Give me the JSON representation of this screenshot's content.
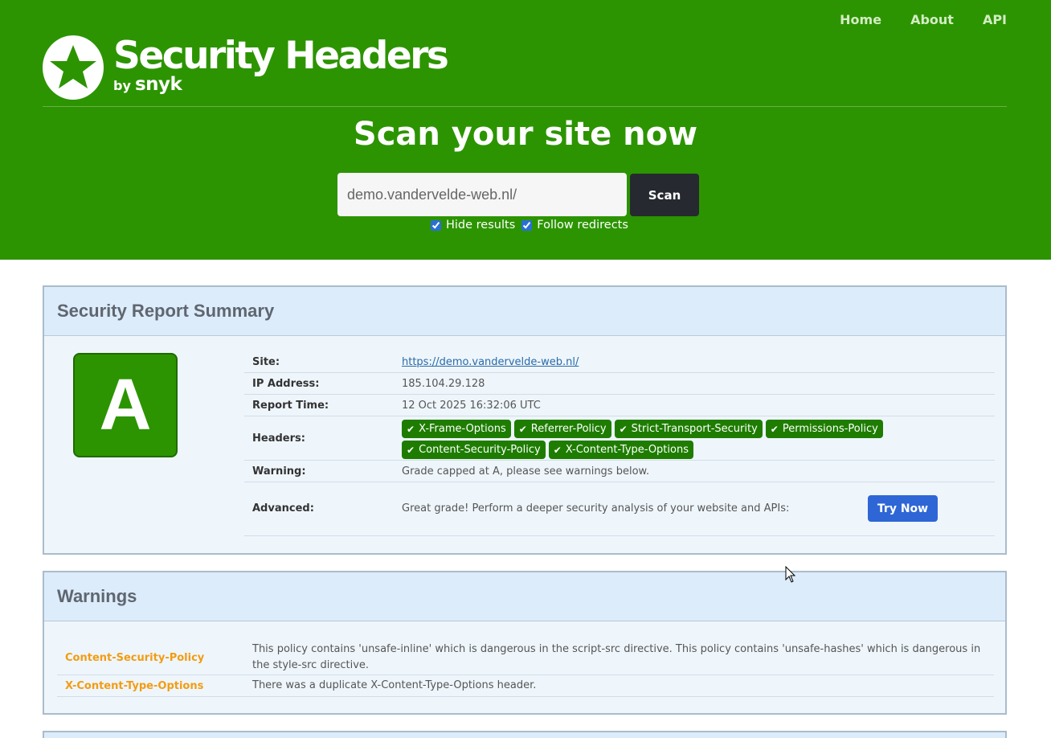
{
  "nav": {
    "home": "Home",
    "about": "About",
    "api": "API"
  },
  "brand": {
    "title": "Security Headers",
    "by": "by",
    "partner": "snyk",
    "icon": "star-icon"
  },
  "scan": {
    "heading": "Scan your site now",
    "input_value": "demo.vandervelde-web.nl/",
    "button": "Scan",
    "hide_results": "Hide results",
    "follow_redirects": "Follow redirects"
  },
  "summary": {
    "title": "Security Report Summary",
    "grade": "A",
    "site_label": "Site:",
    "site_value": "https://demo.vandervelde-web.nl/",
    "ip_label": "IP Address:",
    "ip_value": "185.104.29.128",
    "time_label": "Report Time:",
    "time_value": "12 Oct 2025 16:32:06 UTC",
    "headers_label": "Headers:",
    "headers": [
      "X-Frame-Options",
      "Referrer-Policy",
      "Strict-Transport-Security",
      "Permissions-Policy",
      "Content-Security-Policy",
      "X-Content-Type-Options"
    ],
    "warning_label": "Warning:",
    "warning_value": "Grade capped at A, please see warnings below.",
    "advanced_label": "Advanced:",
    "advanced_value": "Great grade! Perform a deeper security analysis of your website and APIs:",
    "try_button": "Try Now"
  },
  "warnings": {
    "title": "Warnings",
    "items": [
      {
        "header": "Content-Security-Policy",
        "text": "This policy contains 'unsafe-inline' which is dangerous in the script-src directive. This policy contains 'unsafe-hashes' which is dangerous in the style-src directive."
      },
      {
        "header": "X-Content-Type-Options",
        "text": "There was a duplicate X-Content-Type-Options header."
      }
    ]
  },
  "colors": {
    "header_green": "#2c9400",
    "badge_green": "#1e7d00",
    "warning_orange": "#f39c12",
    "try_blue": "#2e66d6"
  }
}
